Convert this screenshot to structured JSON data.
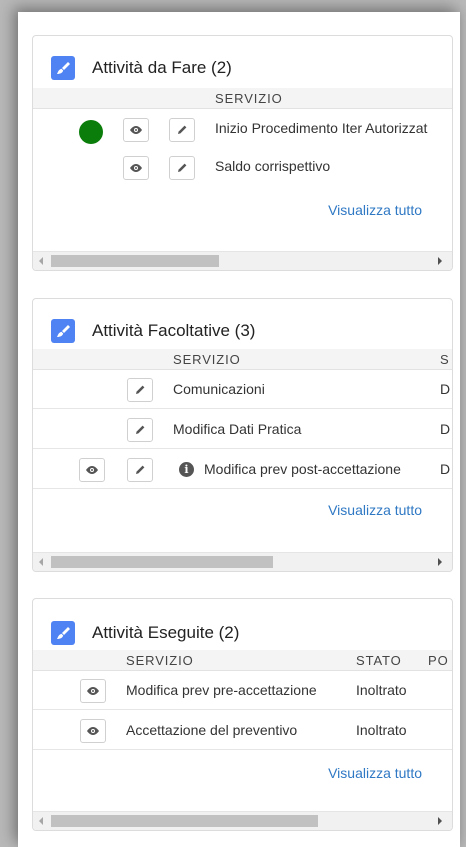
{
  "panels": [
    {
      "title": "Attività da Fare (2)",
      "headers": [
        "SERVIZIO"
      ],
      "rows": [
        {
          "servizio": "Inizio Procedimento Iter Autorizzat"
        },
        {
          "servizio": "Saldo corrispettivo"
        }
      ],
      "link": "Visualizza tutto"
    },
    {
      "title": "Attività Facoltative (3)",
      "headers": [
        "SERVIZIO",
        "S"
      ],
      "rows": [
        {
          "servizio": "Comunicazioni",
          "extra": "D"
        },
        {
          "servizio": "Modifica Dati Pratica",
          "extra": "D"
        },
        {
          "servizio": "Modifica prev post-accettazione",
          "extra": "D"
        }
      ],
      "link": "Visualizza tutto"
    },
    {
      "title": "Attività Eseguite (2)",
      "headers": [
        "SERVIZIO",
        "STATO",
        "PO"
      ],
      "rows": [
        {
          "servizio": "Modifica prev pre-accettazione",
          "stato": "Inoltrato"
        },
        {
          "servizio": "Accettazione del preventivo",
          "stato": "Inoltrato"
        }
      ],
      "link": "Visualizza tutto"
    }
  ],
  "icons": {
    "panel": "paint-brush-icon",
    "view": "eye-icon",
    "edit": "pencil-icon",
    "info": "info-icon",
    "status": "green-status-dot"
  },
  "colors": {
    "accent_blue": "#4f82f2",
    "link": "#2f78c4",
    "status_green": "#0a7d0a"
  }
}
